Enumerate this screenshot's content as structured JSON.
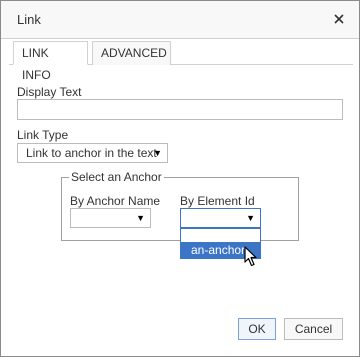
{
  "dialog": {
    "title": "Link",
    "close_glyph": "×"
  },
  "tabs": [
    {
      "label": "LINK INFO",
      "active": true
    },
    {
      "label": "ADVANCED",
      "active": false
    }
  ],
  "display_text": {
    "label": "Display Text",
    "value": ""
  },
  "link_type": {
    "label": "Link Type",
    "selected": "Link to anchor in the text"
  },
  "anchor_group": {
    "legend": "Select an Anchor",
    "by_name_label": "By Anchor Name",
    "by_name_selected": "",
    "by_id_label": "By Element Id",
    "by_id_selected": "",
    "dropdown_options": [
      "",
      "an-anchor"
    ],
    "highlighted_option": "an-anchor"
  },
  "buttons": {
    "ok": "OK",
    "cancel": "Cancel"
  },
  "colors": {
    "accent": "#3c74c6",
    "border": "#bcbcbc",
    "titlebar": "#f8f8f8"
  },
  "icons": {
    "close": "close-icon",
    "dropdown_arrow": "caret-down-icon",
    "cursor": "mouse-pointer-icon"
  }
}
